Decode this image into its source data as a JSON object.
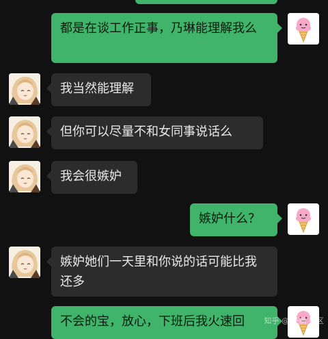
{
  "conversation": {
    "messages": [
      {
        "side": "right",
        "sender": "self",
        "text": ""
      },
      {
        "side": "right",
        "sender": "self",
        "text": "都是在谈工作正事，乃琳能理解我么"
      },
      {
        "side": "left",
        "sender": "other",
        "text": "我当然能理解"
      },
      {
        "side": "left",
        "sender": "other",
        "text": "但你可以尽量不和女同事说话么"
      },
      {
        "side": "left",
        "sender": "other",
        "text": "我会很嫉妒"
      },
      {
        "side": "right",
        "sender": "self",
        "text": "嫉妒什么？"
      },
      {
        "side": "left",
        "sender": "other",
        "text": "嫉妒她们一天里和你说的话可能比我还多"
      },
      {
        "side": "right",
        "sender": "self",
        "text": "不会的宝，放心，下班后我火速回"
      }
    ]
  },
  "watermark": "知乎 @ 狂飙 社区",
  "colors": {
    "background": "#111111",
    "incoming_bubble": "#2c2c2c",
    "outgoing_bubble": "#3fb46a"
  },
  "icons": {
    "self_avatar": "ice-cream-cone-icon",
    "other_avatar": "anime-girl-avatar"
  }
}
